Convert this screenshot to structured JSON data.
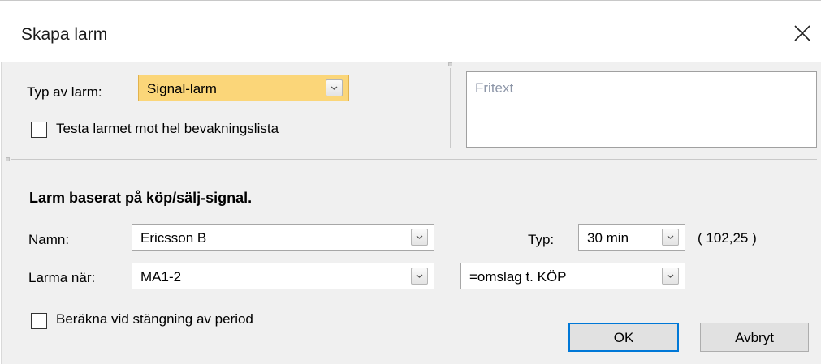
{
  "dialog": {
    "title": "Skapa larm"
  },
  "alarm_type": {
    "label": "Typ av larm:",
    "value": "Signal-larm"
  },
  "test_watchlist": {
    "label": "Testa larmet mot hel bevakningslista",
    "checked": false
  },
  "freetext": {
    "placeholder": "Fritext"
  },
  "section_title": "Larm baserat på köp/sälj-signal.",
  "name": {
    "label": "Namn:",
    "value": "Ericsson B"
  },
  "type": {
    "label": "Typ:",
    "value": "30 min"
  },
  "price": "( 102,25 )",
  "alert_when": {
    "label": "Larma när:",
    "value": "MA1-2",
    "condition": "=omslag t. KÖP"
  },
  "calc_on_close": {
    "label": "Beräkna vid stängning av period",
    "checked": false
  },
  "buttons": {
    "ok": "OK",
    "cancel": "Avbryt"
  },
  "colors": {
    "highlight": "#fbd679",
    "default_button_border": "#0078d7",
    "client_bg": "#f0f0f0"
  }
}
